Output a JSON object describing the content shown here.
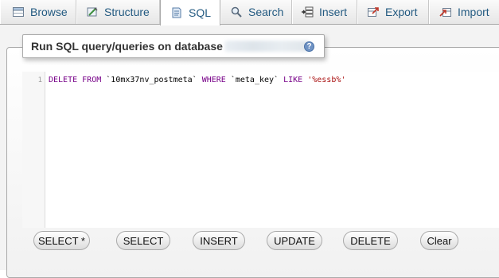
{
  "tabs": [
    {
      "label": "Browse",
      "icon": "browse-table-icon"
    },
    {
      "label": "Structure",
      "icon": "structure-icon"
    },
    {
      "label": "SQL",
      "icon": "sql-document-icon"
    },
    {
      "label": "Search",
      "icon": "magnifier-icon"
    },
    {
      "label": "Insert",
      "icon": "insert-row-icon"
    },
    {
      "label": "Export",
      "icon": "export-icon"
    },
    {
      "label": "Import",
      "icon": "import-icon"
    }
  ],
  "active_tab": "SQL",
  "panel": {
    "title": "Run SQL query/queries on database"
  },
  "editor": {
    "line_number": "1",
    "tokens": {
      "kw1": "DELETE",
      "kw2": "FROM",
      "table": "`10mx37nv_postmeta`",
      "kw3": "WHERE",
      "column": "`meta_key`",
      "kw4": "LIKE",
      "value": "'%essb%'"
    }
  },
  "buttons": {
    "select_star": "SELECT *",
    "select": "SELECT",
    "insert": "INSERT",
    "update": "UPDATE",
    "delete": "DELETE",
    "clear": "Clear"
  },
  "colors": {
    "tab_text": "#235a81",
    "keyword": "#770088",
    "string": "#aa1111"
  }
}
